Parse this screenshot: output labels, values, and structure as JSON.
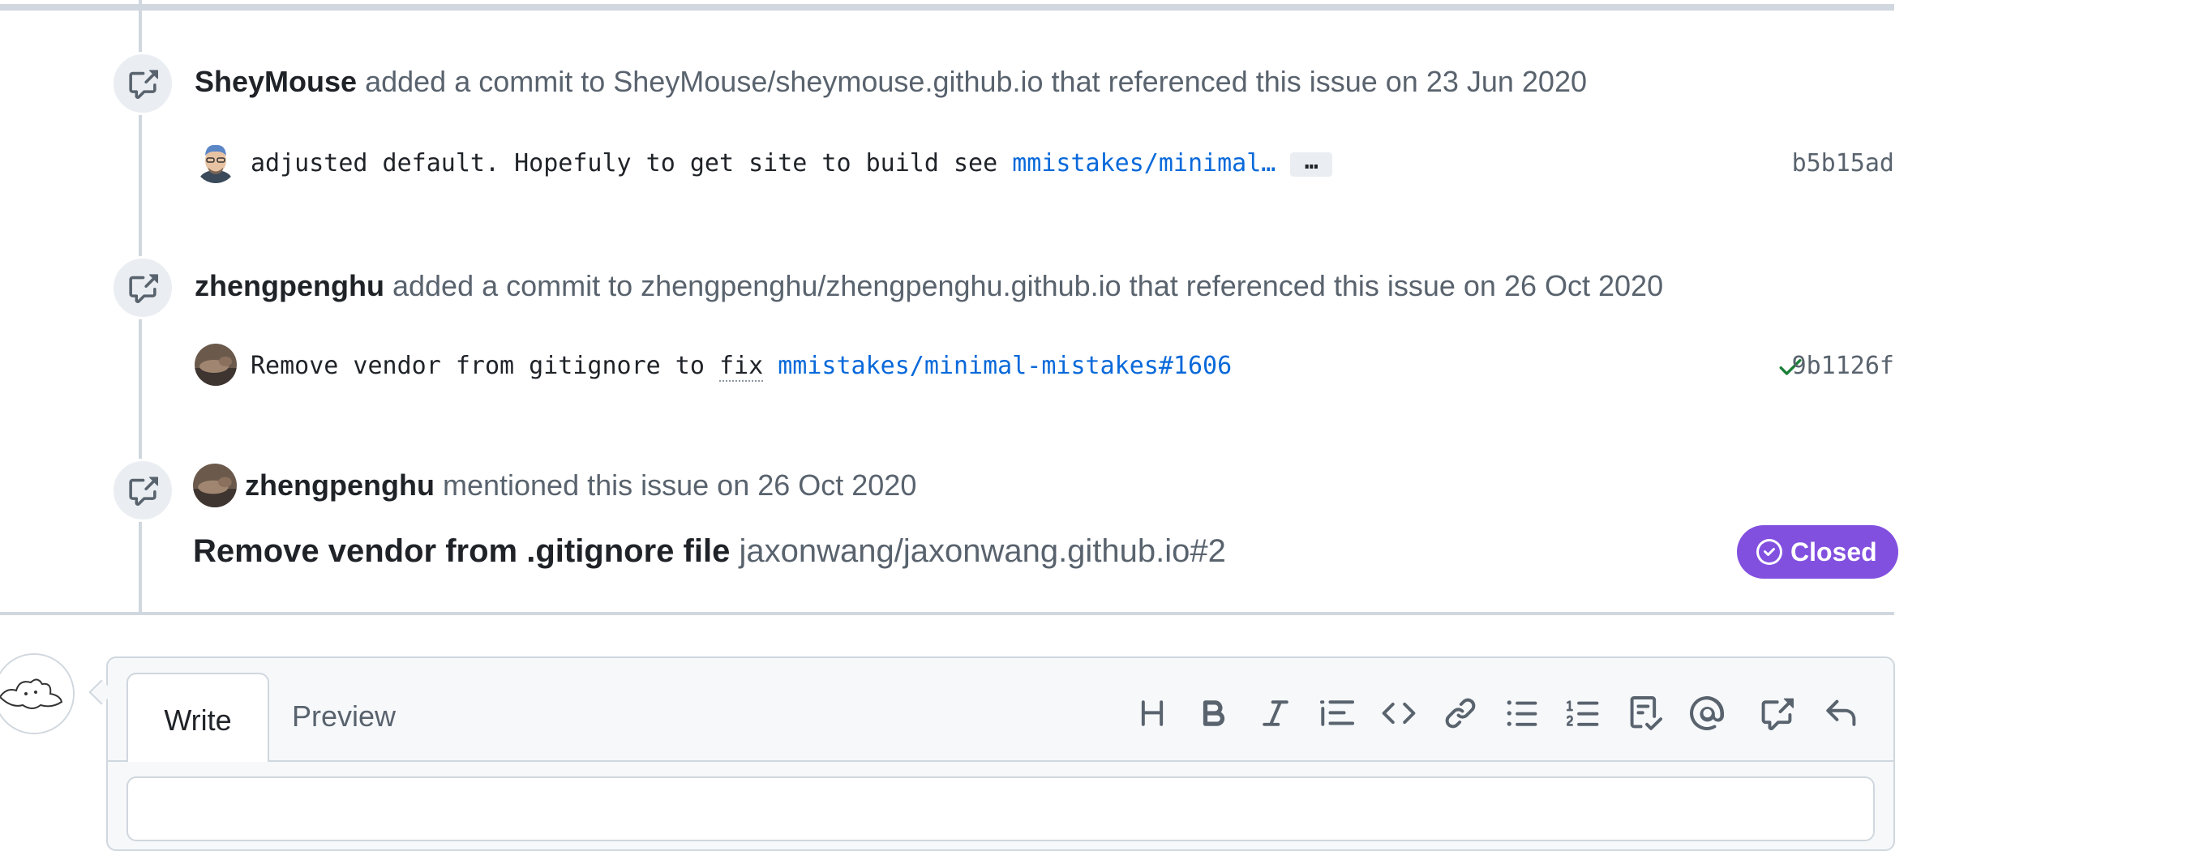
{
  "timeline": {
    "events": [
      {
        "actor": "SheyMouse",
        "text": "added a commit to SheyMouse/sheymouse.github.io that referenced this issue on 23 Jun 2020",
        "commit": {
          "message": "adjusted default. Hopefuly to get site to build see",
          "link": "mmistakes/minimal…",
          "ellipsis": "…",
          "sha": "b5b15ad"
        }
      },
      {
        "actor": "zhengpenghu",
        "text": "added a commit to zhengpenghu/zhengpenghu.github.io that referenced this issue on 26 Oct 2020",
        "commit": {
          "message_a": "Remove vendor from gitignore to",
          "message_b": "fix",
          "link": "mmistakes/minimal-mistakes#1606",
          "sha": "9b1126f"
        }
      },
      {
        "actor": "zhengpenghu",
        "text": "mentioned this issue on 26 Oct 2020",
        "reference": {
          "title": "Remove vendor from .gitignore file",
          "number": "jaxonwang/jaxonwang.github.io#2",
          "state": "Closed"
        }
      }
    ]
  },
  "composer": {
    "tabs": {
      "write": "Write",
      "preview": "Preview"
    },
    "toolbar": [
      "heading-icon",
      "bold-icon",
      "italic-icon",
      "quote-icon",
      "code-icon",
      "link-icon",
      "unordered-list-icon",
      "ordered-list-icon",
      "task-list-icon",
      "mention-icon",
      "cross-reference-icon",
      "reply-icon"
    ]
  },
  "colors": {
    "link": "#0969da",
    "closed": "#8250df",
    "success": "#1a7f37",
    "muted": "#59636e",
    "border": "#d0d7de"
  }
}
